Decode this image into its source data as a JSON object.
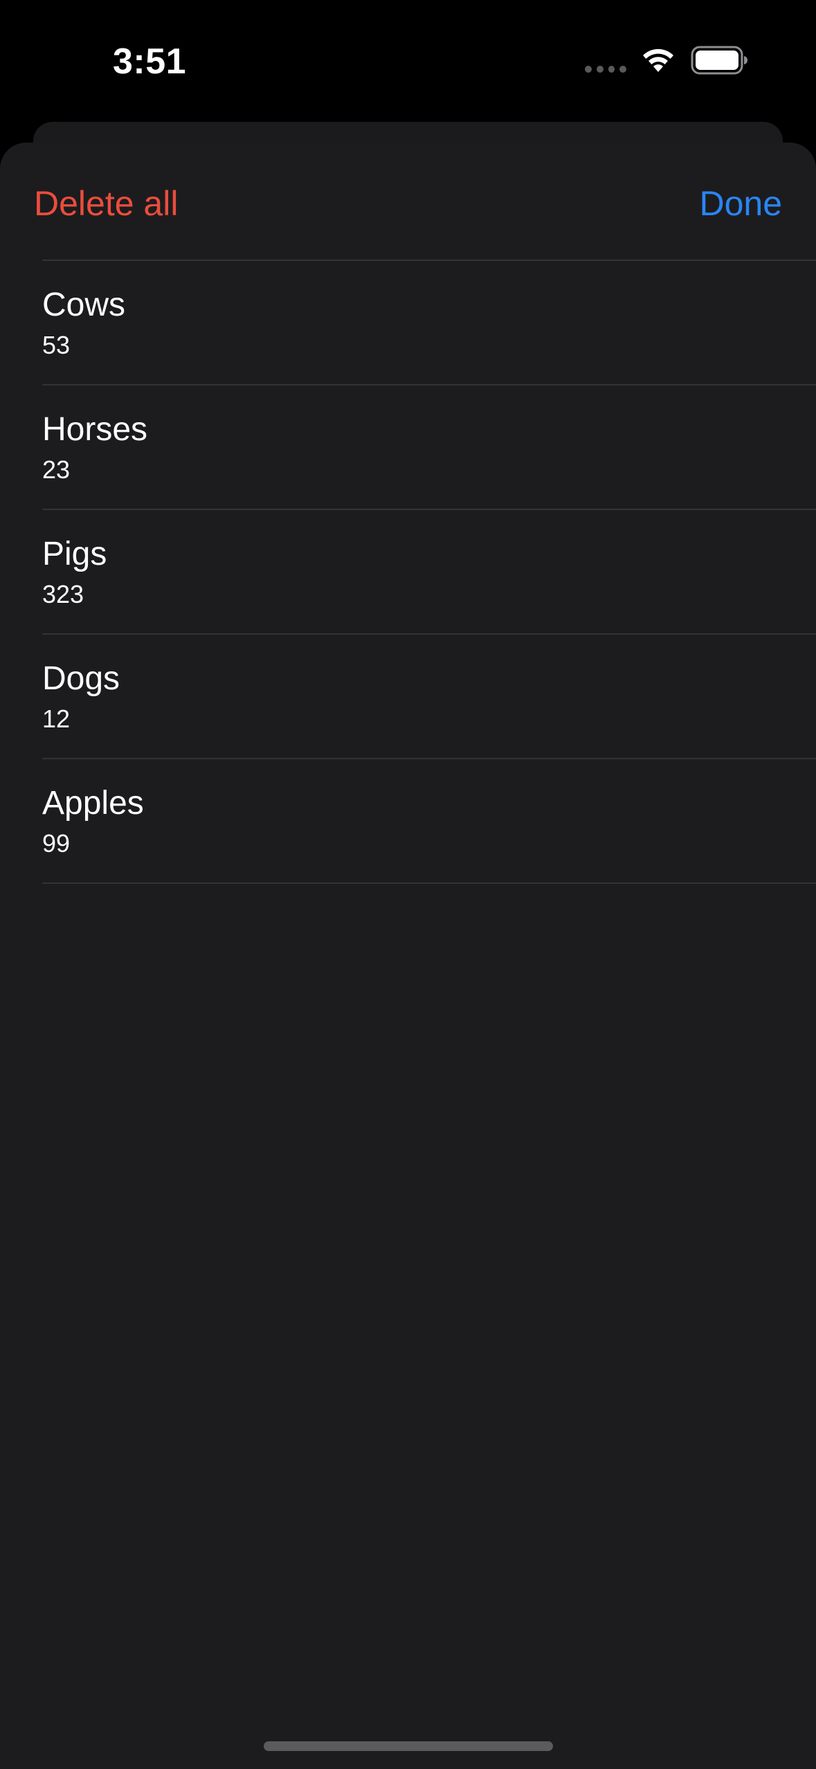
{
  "status_bar": {
    "time": "3:51",
    "icons": [
      "cellular-signal-icon",
      "wifi-icon",
      "battery-icon"
    ]
  },
  "sheet": {
    "delete_all_label": "Delete all",
    "done_label": "Done",
    "items": [
      {
        "title": "Cows",
        "count": "53"
      },
      {
        "title": "Horses",
        "count": "23"
      },
      {
        "title": "Pigs",
        "count": "323"
      },
      {
        "title": "Dogs",
        "count": "12"
      },
      {
        "title": "Apples",
        "count": "99"
      }
    ]
  },
  "colors": {
    "background": "#000000",
    "sheet_background": "#1c1c1e",
    "destructive": "#eb4d3d",
    "accent": "#2a85f5",
    "separator": "#333336"
  }
}
